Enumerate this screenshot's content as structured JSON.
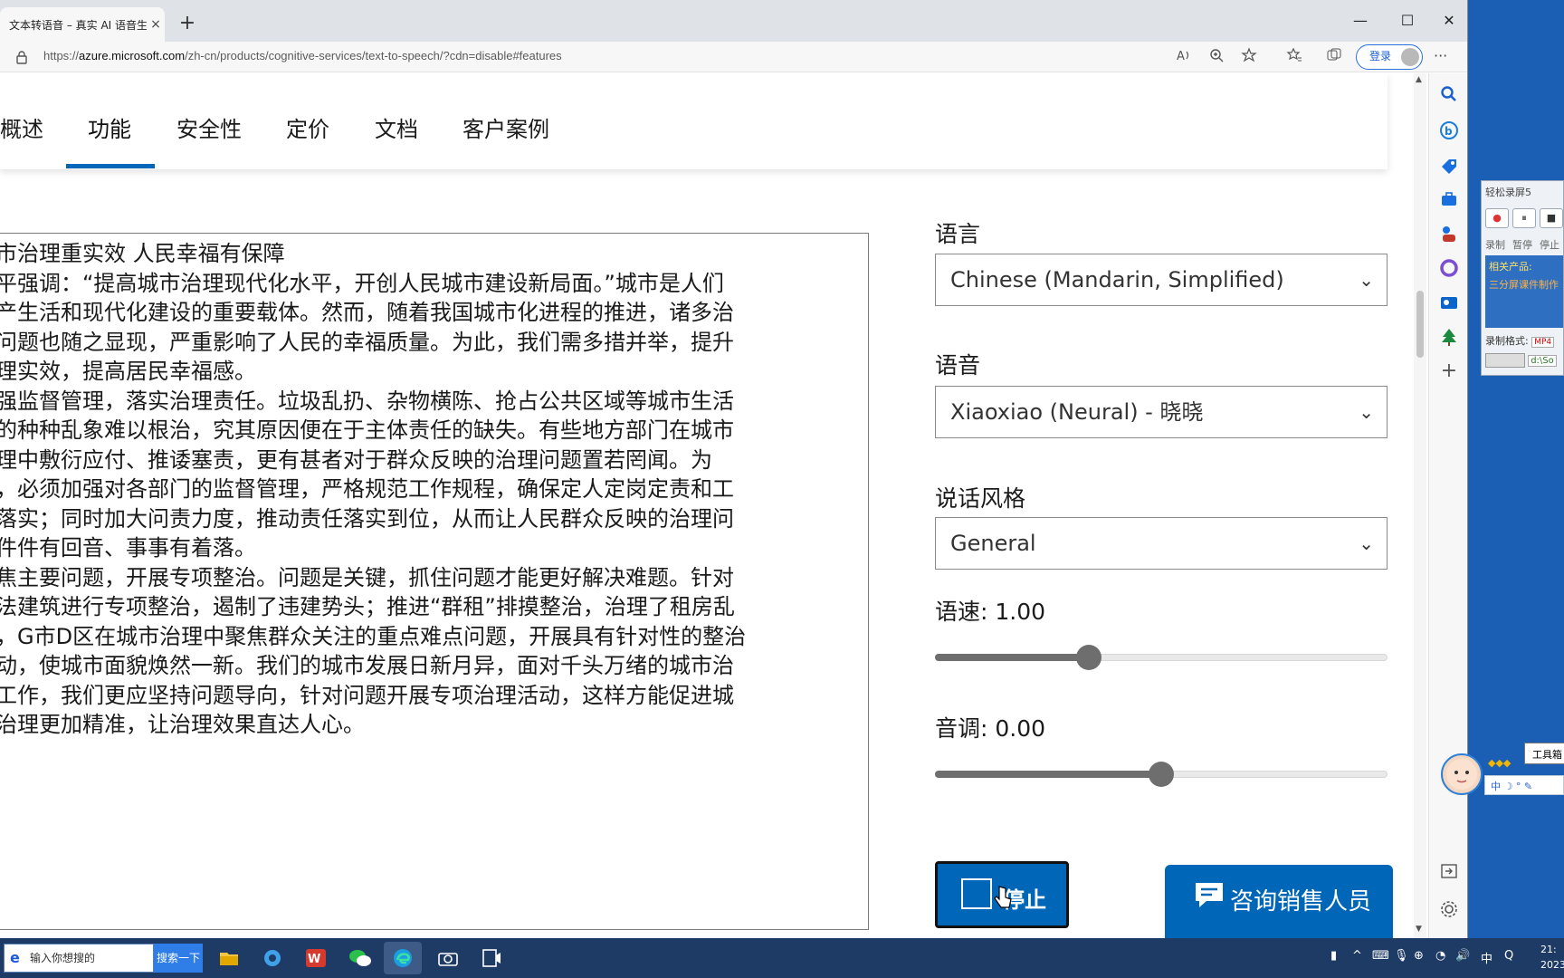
{
  "browser": {
    "tab_title": "文本转语音 – 真实 AI 语音生",
    "tab_close": "×",
    "new_tab": "+",
    "url_prefix": "https://",
    "url_domain": "azure.microsoft.com",
    "url_path": "/zh-cn/products/cognitive-services/text-to-speech/?cdn=disable#features",
    "login_label": "登录",
    "more": "···",
    "win_minimize": "—",
    "win_maximize": "☐",
    "win_close": "✕"
  },
  "subnav": {
    "items": [
      "概述",
      "功能",
      "安全性",
      "定价",
      "文档",
      "客户案例"
    ],
    "active_index": 1
  },
  "textbox": {
    "lines": [
      "市治理重实效 人民幸福有保障",
      "平强调：“提高城市治理现代化水平，开创人民城市建设新局面。”城市是人们",
      "产生活和现代化建设的重要载体。然而，随着我国城市化进程的推进，诸多治",
      "问题也随之显现，严重影响了人民的幸福质量。为此，我们需多措并举，提升",
      "理实效，提高居民幸福感。",
      "强监督管理，落实治理责任。垃圾乱扔、杂物横陈、抢占公共区域等城市生活",
      "的种种乱象难以根治，究其原因便在于主体责任的缺失。有些地方部门在城市",
      "理中敷衍应付、推诿塞责，更有甚者对于群众反映的治理问题置若罔闻。为",
      "，必须加强对各部门的监督管理，严格规范工作规程，确保定人定岗定责和工",
      "落实；同时加大问责力度，推动责任落实到位，从而让人民群众反映的治理问",
      "件件有回音、事事有着落。",
      "焦主要问题，开展专项整治。问题是关键，抓住问题才能更好解决难题。针对",
      "法建筑进行专项整治，遏制了违建势头；推进“群租”排摸整治，治理了租房乱",
      "，G市D区在城市治理中聚焦群众关注的重点难点问题，开展具有针对性的整治",
      "动，使城市面貌焕然一新。我们的城市发展日新月异，面对千头万绪的城市治",
      "工作，我们更应坚持问题导向，针对问题开展专项治理活动，这样方能促进城",
      "治理更加精准，让治理效果直达人心。"
    ]
  },
  "panel": {
    "language_label": "语言",
    "language_value": "Chinese (Mandarin, Simplified)",
    "voice_label": "语音",
    "voice_value": "Xiaoxiao (Neural) - 晓晓",
    "style_label": "说话风格",
    "style_value": "General",
    "rate_label": "语速: 1.00",
    "rate_fraction": 0.34,
    "pitch_label": "音调: 0.00",
    "pitch_fraction": 0.5,
    "chevron": "⌄",
    "stop_label": "停止",
    "sales_label": "咨询销售人员"
  },
  "recorder": {
    "title": "轻松录屏5",
    "btn_record": "●",
    "btn_pause": "⏸",
    "btn_stop": "■",
    "lbl_record": "录制",
    "lbl_pause": "暂停",
    "lbl_stop": "停止",
    "promo_title": "相关产品:",
    "promo_item": "三分屏课件制作",
    "format_label": "录制格式:",
    "format_value": "MP4",
    "path_value": "d:\\So"
  },
  "floating": {
    "tools_tip": "工具箱",
    "ime": "中 ☽ ° ✎"
  },
  "taskbar": {
    "search_placeholder": "输入你想搜的",
    "search_btn": "搜索一下",
    "ime_lang": "中",
    "clock_time": "21:",
    "clock_date": "2023"
  },
  "colors": {
    "accent": "#0067b8",
    "taskbar": "#1e3b66"
  }
}
